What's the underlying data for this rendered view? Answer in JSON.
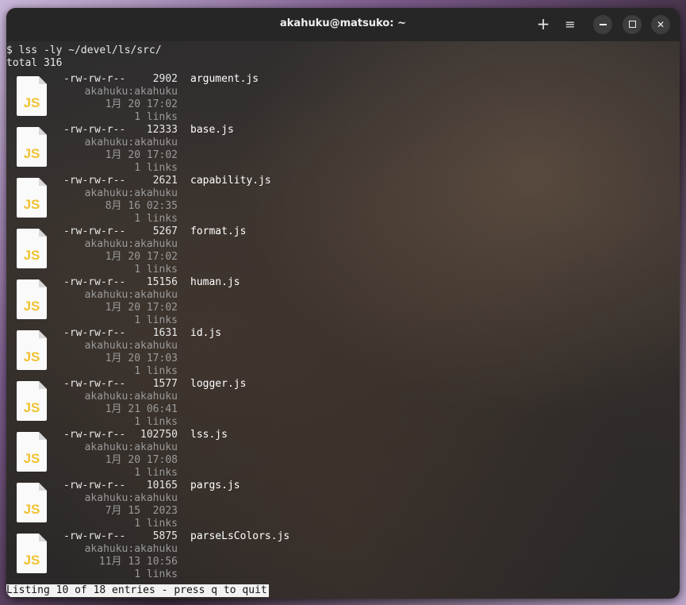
{
  "window": {
    "title": "akahuku@matsuko: ~",
    "buttons": {
      "new_tab": "+",
      "menu": "≡",
      "close": "✕"
    }
  },
  "terminal": {
    "command": "$ lss -ly ~/devel/ls/src/",
    "total": "total 316",
    "entries": [
      {
        "perm": "-rw-rw-r--",
        "size": "2902",
        "name": "argument.js",
        "owner": "akahuku:akahuku",
        "mtime": "1月 20 17:02",
        "links": "1 links",
        "icon": "js-file-icon"
      },
      {
        "perm": "-rw-rw-r--",
        "size": "12333",
        "name": "base.js",
        "owner": "akahuku:akahuku",
        "mtime": "1月 20 17:02",
        "links": "1 links",
        "icon": "js-file-icon"
      },
      {
        "perm": "-rw-rw-r--",
        "size": "2621",
        "name": "capability.js",
        "owner": "akahuku:akahuku",
        "mtime": "8月 16 02:35",
        "links": "1 links",
        "icon": "js-file-icon"
      },
      {
        "perm": "-rw-rw-r--",
        "size": "5267",
        "name": "format.js",
        "owner": "akahuku:akahuku",
        "mtime": "1月 20 17:02",
        "links": "1 links",
        "icon": "js-file-icon"
      },
      {
        "perm": "-rw-rw-r--",
        "size": "15156",
        "name": "human.js",
        "owner": "akahuku:akahuku",
        "mtime": "1月 20 17:02",
        "links": "1 links",
        "icon": "js-file-icon"
      },
      {
        "perm": "-rw-rw-r--",
        "size": "1631",
        "name": "id.js",
        "owner": "akahuku:akahuku",
        "mtime": "1月 20 17:03",
        "links": "1 links",
        "icon": "js-file-icon"
      },
      {
        "perm": "-rw-rw-r--",
        "size": "1577",
        "name": "logger.js",
        "owner": "akahuku:akahuku",
        "mtime": "1月 21 06:41",
        "links": "1 links",
        "icon": "js-file-icon"
      },
      {
        "perm": "-rw-rw-r--",
        "size": "102750",
        "name": "lss.js",
        "owner": "akahuku:akahuku",
        "mtime": "1月 20 17:08",
        "links": "1 links",
        "icon": "js-file-icon"
      },
      {
        "perm": "-rw-rw-r--",
        "size": "10165",
        "name": "pargs.js",
        "owner": "akahuku:akahuku",
        "mtime": "7月 15  2023",
        "links": "1 links",
        "icon": "js-file-icon"
      },
      {
        "perm": "-rw-rw-r--",
        "size": "5875",
        "name": "parseLsColors.js",
        "owner": "akahuku:akahuku",
        "mtime": "11月 13 10:56",
        "links": "1 links",
        "icon": "js-file-icon"
      }
    ],
    "icon_label": "JS",
    "status": "Listing 10 of 18 entries - press q to quit"
  },
  "colors": {
    "js_icon_text": "#f0c232",
    "js_icon_page": "#fafafa",
    "status_bg": "#f2f2f2"
  }
}
